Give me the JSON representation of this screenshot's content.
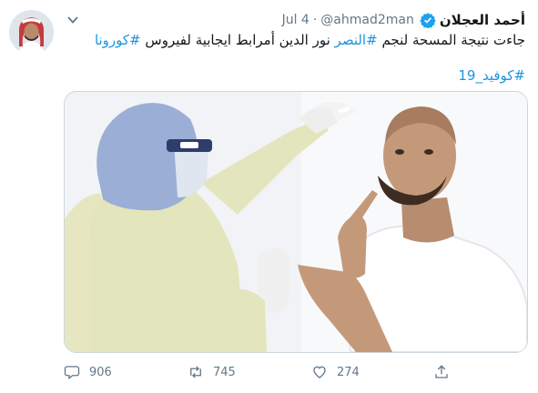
{
  "tweet": {
    "display_name": "أحمد العجلان",
    "handle": "@ahmad2man",
    "date": "Jul 4",
    "text_main": "جاءت نتيجة المسحة لنجم ",
    "hashtag_club": "#النصر",
    "text_rest": " نور الدين أمرابط ايجابية لفيروس ",
    "hashtag_corona": "#كورونا",
    "hashtag_covid": "#كوفيد_19"
  },
  "actions": {
    "replies": "906",
    "retweets": "745",
    "likes": "274"
  },
  "colors": {
    "link": "#1b95e0",
    "meta": "#657786",
    "verified": "#1da1f2"
  },
  "icons": [
    "chevron-down-icon",
    "verified-badge-icon",
    "reply-icon",
    "retweet-icon",
    "like-icon",
    "share-icon"
  ]
}
